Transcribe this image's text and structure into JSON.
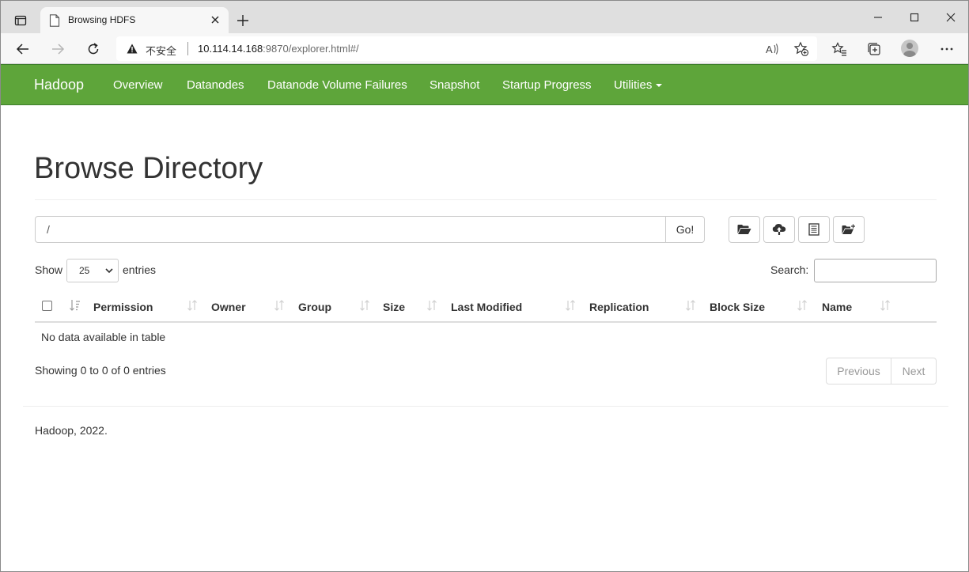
{
  "browser": {
    "tab": {
      "title": "Browsing HDFS"
    },
    "address": {
      "security_label": "不安全",
      "url_host": "10.114.14.168",
      "url_rest": ":9870/explorer.html#/"
    },
    "icons": {
      "tab_actions": "tab-actions-icon",
      "close_tab": "close-icon",
      "new_tab": "plus-icon",
      "minimize": "minimize-icon",
      "maximize": "maximize-icon",
      "close_window": "close-icon",
      "back": "arrow-left-icon",
      "forward": "arrow-right-icon",
      "refresh": "refresh-icon",
      "warning": "warning-icon",
      "read_aloud": "read-aloud-icon",
      "add_favorite": "star-add-icon",
      "favorites": "favorites-icon",
      "collections": "collections-icon",
      "profile": "avatar-icon",
      "menu": "more-icon"
    }
  },
  "navbar": {
    "brand": "Hadoop",
    "color": "#5ea53a",
    "links": [
      "Overview",
      "Datanodes",
      "Datanode Volume Failures",
      "Snapshot",
      "Startup Progress",
      "Utilities"
    ]
  },
  "page": {
    "title": "Browse Directory",
    "path_value": "/",
    "go_label": "Go!",
    "toolbar_icons": [
      "folder-open-icon",
      "cloud-upload-icon",
      "list-icon",
      "new-folder-icon"
    ]
  },
  "table": {
    "show_label": "Show",
    "page_length": "25",
    "entries_label": "entries",
    "search_label": "Search:",
    "columns": [
      "Permission",
      "Owner",
      "Group",
      "Size",
      "Last Modified",
      "Replication",
      "Block Size",
      "Name"
    ],
    "empty_message": "No data available in table",
    "info": "Showing 0 to 0 of 0 entries",
    "pagination": {
      "previous": "Previous",
      "next": "Next"
    }
  },
  "footer": {
    "text": "Hadoop, 2022."
  }
}
